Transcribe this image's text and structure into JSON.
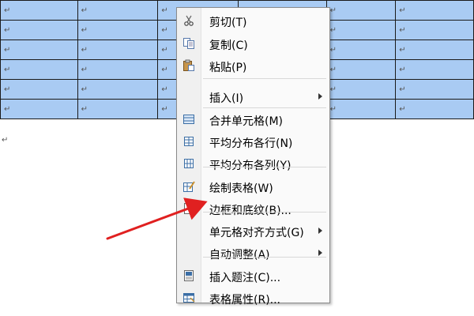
{
  "table": {
    "mark": "↵",
    "rows": [
      [
        "↵",
        "↵",
        "↵",
        "↵",
        "↵",
        "↵"
      ],
      [
        "↵",
        "↵",
        "↵",
        "↵",
        "↵",
        "↵"
      ],
      [
        "↵",
        "↵",
        "↵",
        "↵",
        "↵",
        "↵"
      ],
      [
        "↵",
        "↵",
        "↵",
        "↵",
        "↵",
        "↵"
      ],
      [
        "↵",
        "↵",
        "↵",
        "↵",
        "↵",
        "↵"
      ],
      [
        "↵",
        "↵",
        "↵",
        "↵",
        "↵",
        "↵"
      ]
    ],
    "selection_color": "#a9cbf3"
  },
  "after_table_mark": "↵",
  "context_menu": {
    "items": [
      {
        "label": "剪切(T)",
        "icon": "scissors-icon",
        "submenu": false
      },
      {
        "label": "复制(C)",
        "icon": "copy-icon",
        "submenu": false
      },
      {
        "label": "粘贴(P)",
        "icon": "paste-icon",
        "submenu": false
      },
      {
        "label": "插入(I)",
        "icon": "",
        "submenu": true
      },
      {
        "label": "合并单元格(M)",
        "icon": "merge-cells-icon",
        "submenu": false
      },
      {
        "label": "平均分布各行(N)",
        "icon": "distribute-rows-icon",
        "submenu": false
      },
      {
        "label": "平均分布各列(Y)",
        "icon": "distribute-columns-icon",
        "submenu": false
      },
      {
        "label": "绘制表格(W)",
        "icon": "draw-table-icon",
        "submenu": false
      },
      {
        "label": "边框和底纹(B)...",
        "icon": "borders-shading-icon",
        "submenu": false
      },
      {
        "label": "单元格对齐方式(G)",
        "icon": "",
        "submenu": true
      },
      {
        "label": "自动调整(A)",
        "icon": "",
        "submenu": true
      },
      {
        "label": "插入题注(C)...",
        "icon": "insert-caption-icon",
        "submenu": false
      },
      {
        "label": "表格属性(R)...",
        "icon": "table-properties-icon",
        "submenu": false
      }
    ]
  },
  "annotation": {
    "color": "#e02020"
  }
}
